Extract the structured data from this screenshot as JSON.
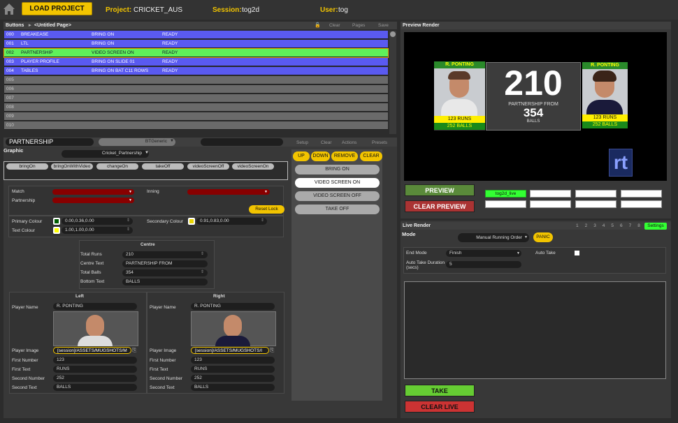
{
  "topbar": {
    "load_label": "LOAD PROJECT",
    "project_label": "Project:",
    "project_value": "CRICKET_AUS",
    "session_label": "Session:",
    "session_value": "tog2d",
    "user_label": "User:",
    "user_value": "tog"
  },
  "buttons_panel": {
    "title": "Buttons",
    "page": "<Untitled Page>",
    "clear": "Clear",
    "pages": "Pages",
    "save": "Save",
    "rows": [
      {
        "id": "000",
        "name": "BREAKEASE",
        "action": "BRING ON",
        "status": "READY"
      },
      {
        "id": "001",
        "name": "LTL",
        "action": "BRING ON",
        "status": "READY"
      },
      {
        "id": "002",
        "name": "PARTNERSHIP",
        "action": "VIDEO SCREEN ON",
        "status": "READY"
      },
      {
        "id": "003",
        "name": "PLAYER PROFILE",
        "action": "BRING ON SLIDE 01",
        "status": "READY"
      },
      {
        "id": "004",
        "name": "TABLES",
        "action": "BRING ON BAT C11 ROWS",
        "status": "READY"
      },
      {
        "id": "005",
        "name": "",
        "action": "",
        "status": ""
      },
      {
        "id": "006",
        "name": "",
        "action": "",
        "status": ""
      },
      {
        "id": "007",
        "name": "",
        "action": "",
        "status": ""
      },
      {
        "id": "008",
        "name": "",
        "action": "",
        "status": ""
      },
      {
        "id": "009",
        "name": "",
        "action": "",
        "status": ""
      },
      {
        "id": "010",
        "name": "",
        "action": "",
        "status": ""
      }
    ]
  },
  "editor": {
    "name": "PARTNERSHIP",
    "template": "BTGeneric",
    "setup": "Setup",
    "clear": "Clear",
    "actions": "Actions",
    "presets": "Presets",
    "graphic_label": "Graphic",
    "graphic_value": "Cricket_Partnership",
    "commands": [
      "bringOn",
      "bringOnWithVideo",
      "changeOn",
      "takeOff",
      "videoScreenOff",
      "videoScreenOn"
    ],
    "match": "Match",
    "partnership": "Partnership",
    "inning": "Inning",
    "reset_lock": "Reset Lock",
    "primary_colour_label": "Primary Colour",
    "primary_colour": "0.00,0.36,0.00",
    "text_colour_label": "Text Colour",
    "text_colour": "1.00,1.00,0.00",
    "secondary_colour_label": "Secondary Colour",
    "secondary_colour": "0.91,0.83,0.00",
    "centre": {
      "title": "Centre",
      "total_runs_label": "Total Runs",
      "total_runs": "210",
      "centre_text_label": "Centre Text",
      "centre_text": "PARTNERSHIP FROM",
      "total_balls_label": "Total Balls",
      "total_balls": "354",
      "bottom_text_label": "Bottom Text",
      "bottom_text": "BALLS"
    },
    "left": {
      "title": "Left",
      "player_name_label": "Player Name",
      "player_name": "R. PONTING",
      "player_image_label": "Player Image",
      "player_image": "[session]/ASSETS/MUGSHOTS/M",
      "first_number_label": "First Number",
      "first_number": "123",
      "first_text_label": "First Text",
      "first_text": "RUNS",
      "second_number_label": "Second Number",
      "second_number": "252",
      "second_text_label": "Second Text",
      "second_text": "BALLS"
    },
    "right": {
      "title": "Right",
      "player_name_label": "Player Name",
      "player_name": "R. PONTING",
      "player_image_label": "Player Image",
      "player_image": "[session]/ASSETS/MUGSHOTS/I",
      "first_number_label": "First Number",
      "first_number": "123",
      "first_text_label": "First Text",
      "first_text": "RUNS",
      "second_number_label": "Second Number",
      "second_number": "252",
      "second_text_label": "Second Text",
      "second_text": "BALLS"
    }
  },
  "actions": {
    "up": "UP",
    "down": "DOWN",
    "remove": "REMOVE",
    "clear": "CLEAR",
    "list": [
      "BRING ON",
      "VIDEO SCREEN ON",
      "VIDEO SCREEN OFF",
      "TAKE OFF"
    ]
  },
  "preview": {
    "title": "Preview Render",
    "left_name": "R. PONTING",
    "left_runs": "123 RUNS",
    "left_balls": "252 BALLS",
    "right_name": "R. PONTING",
    "right_runs": "123 RUNS",
    "right_balls": "252 BALLS",
    "big_number": "210",
    "centre_text": "PARTNERSHIP FROM",
    "balls_number": "354",
    "balls_text": "BALLS",
    "logo": "rt",
    "preview_btn": "PREVIEW",
    "clear_preview_btn": "CLEAR PREVIEW",
    "channel": "tog2d_live"
  },
  "live": {
    "title": "Live Render",
    "tabs": [
      "1",
      "2",
      "3",
      "4",
      "5",
      "6",
      "7",
      "8"
    ],
    "settings": "Settings",
    "mode_label": "Mode",
    "mode_value": "Manual Running Order",
    "panic": "PANIC",
    "end_mode_label": "End Mode",
    "end_mode": "Finish",
    "auto_take_label": "Auto Take",
    "auto_take_duration_label": "Auto Take Duration (secs)",
    "auto_take_duration": "5",
    "take": "TAKE",
    "clear_live": "CLEAR LIVE"
  },
  "colors": {
    "accent": "#f2c400",
    "blue_row": "#5a5af0",
    "green_row": "#5ff05a"
  }
}
